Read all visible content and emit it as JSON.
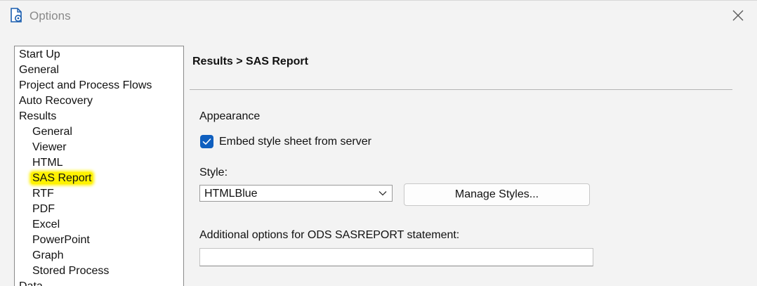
{
  "window": {
    "title": "Options",
    "close_icon": "close-icon",
    "app_icon": "document-gear-icon"
  },
  "tree": {
    "items": [
      {
        "label": "Start Up",
        "level": 0
      },
      {
        "label": "General",
        "level": 0
      },
      {
        "label": "Project and Process Flows",
        "level": 0
      },
      {
        "label": "Auto Recovery",
        "level": 0
      },
      {
        "label": "Results",
        "level": 0
      },
      {
        "label": "General",
        "level": 1
      },
      {
        "label": "Viewer",
        "level": 1
      },
      {
        "label": "HTML",
        "level": 1
      },
      {
        "label": "SAS Report",
        "level": 1,
        "selected": true,
        "highlight_color": "#fff200"
      },
      {
        "label": "RTF",
        "level": 1
      },
      {
        "label": "PDF",
        "level": 1
      },
      {
        "label": "Excel",
        "level": 1
      },
      {
        "label": "PowerPoint",
        "level": 1
      },
      {
        "label": "Graph",
        "level": 1
      },
      {
        "label": "Stored Process",
        "level": 1
      },
      {
        "label": "Data",
        "level": 0
      }
    ]
  },
  "panel": {
    "heading": "Results > SAS Report",
    "appearance_label": "Appearance",
    "embed_checkbox": {
      "label": "Embed style sheet from server",
      "checked": true,
      "color": "#0f5fbf"
    },
    "style_label": "Style:",
    "style_select": {
      "value": "HTMLBlue"
    },
    "manage_styles_button": "Manage Styles...",
    "additional_options_label": "Additional options for ODS SASREPORT statement:",
    "additional_options_value": ""
  }
}
